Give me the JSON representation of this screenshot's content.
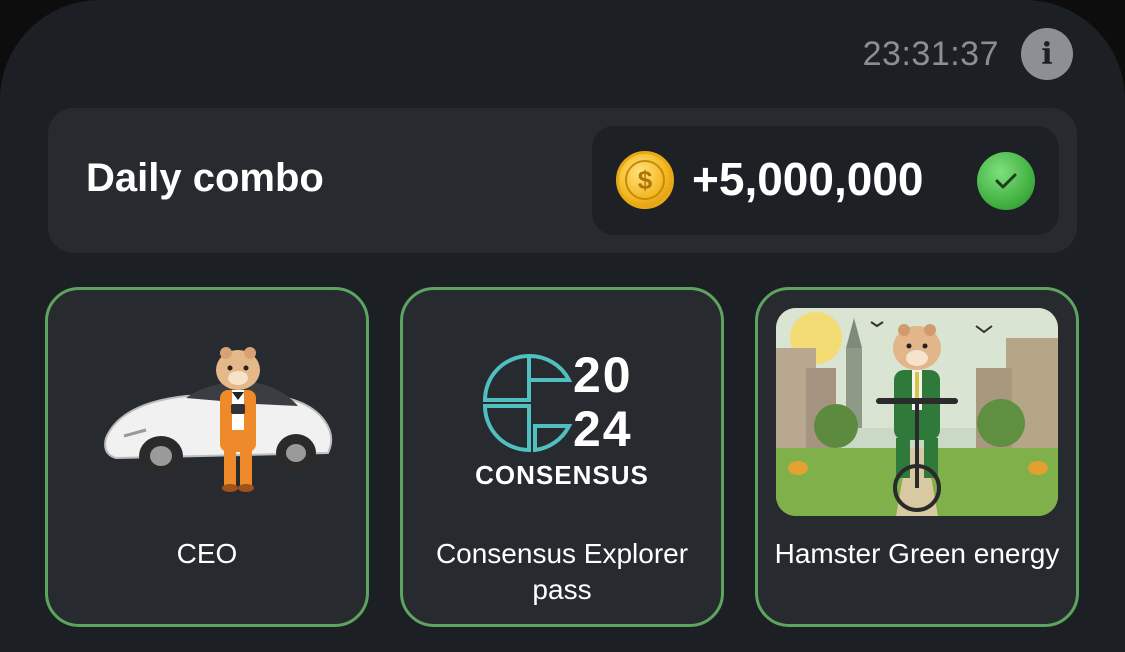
{
  "header": {
    "timer": "23:31:37",
    "info_icon": "info-icon"
  },
  "combo": {
    "title": "Daily combo",
    "reward": "+5,000,000",
    "coin_icon": "coin-icon",
    "coin_symbol": "$",
    "status_icon": "check-icon"
  },
  "cards": [
    {
      "label": "CEO",
      "image": "hamster-with-car"
    },
    {
      "label": "Consensus Explorer pass",
      "image": "consensus-2024-logo",
      "logo_year_top": "20",
      "logo_year_bottom": "24",
      "logo_text": "CONSENSUS"
    },
    {
      "label": "Hamster Green energy",
      "image": "hamster-on-bicycle"
    }
  ],
  "colors": {
    "accent_green": "#5da45e",
    "gold": "#f2b51e",
    "panel": "#1c1f24",
    "card": "#272a2f"
  }
}
